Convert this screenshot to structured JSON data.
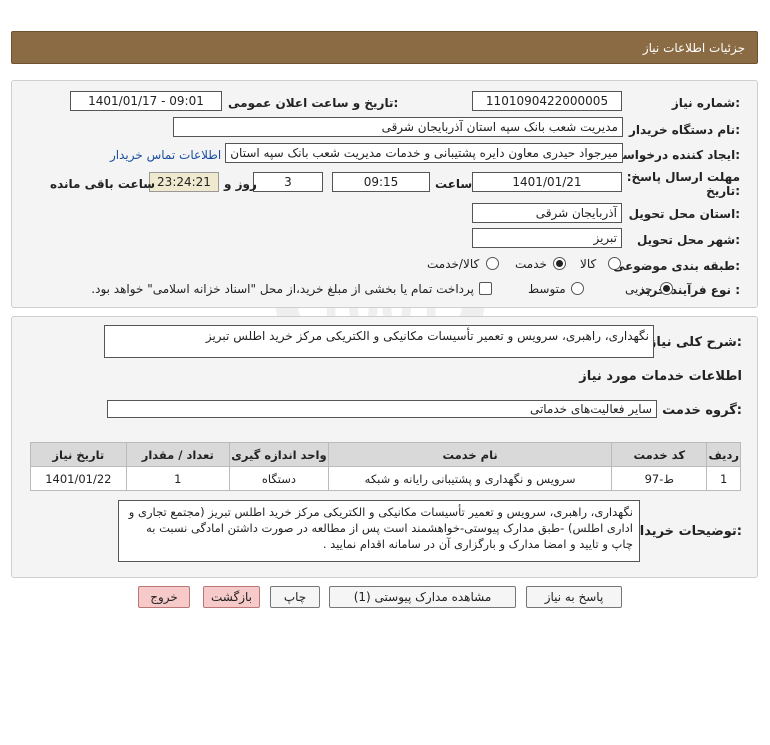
{
  "header": {
    "title": "جزئیات اطلاعات نیاز"
  },
  "form": {
    "need_number_label": "شماره نیاز:",
    "need_number": "1101090422000005",
    "announce_label": "تاریخ و ساعت اعلان عمومی:",
    "announce_value": "1401/01/17 - 09:01",
    "buyer_org_label": "نام دستگاه خریدار:",
    "buyer_org": "مدیریت شعب بانک سپه استان آذربایجان شرقی",
    "creator_label": "ایجاد کننده درخواست:",
    "creator": "میرجواد حیدری معاون دایره پشتیبانی و خدمات مدیریت شعب بانک سپه استان",
    "contact_link": "اطلاعات تماس خریدار",
    "deadline_label_1": "مهلت ارسال پاسخ: تا",
    "deadline_label_2": "تاریخ:",
    "deadline_date": "1401/01/21",
    "hour_label": "ساعت",
    "deadline_time": "09:15",
    "days_count": "3",
    "days_label": "روز و",
    "remaining_time": "23:24:21",
    "remaining_label": "ساعت باقی مانده",
    "province_label": "استان محل تحویل:",
    "province": "آذربایجان شرقی",
    "city_label": "شهر محل تحویل:",
    "city": "تبریز",
    "category_label": "طبقه بندی موضوعی:",
    "category_options": [
      "کالا",
      "خدمت",
      "کالا/خدمت"
    ],
    "category_selected": "خدمت",
    "purchase_type_label": "نوع فرآیند خرید :",
    "purchase_options": [
      "جزیی",
      "متوسط"
    ],
    "purchase_selected": "جزیی",
    "payment_note": "پرداخت تمام یا بخشی از مبلغ خرید،از محل \"اسناد خزانه اسلامی\" خواهد بود."
  },
  "details": {
    "general_desc_label": "شرح کلی نیاز:",
    "general_desc": "نگهداری، راهبری، سرویس و تعمیر تأسیسات مکانیکی و الکتریکی مرکز خرید اطلس تبریز",
    "services_heading": "اطلاعات خدمات مورد نیاز",
    "service_group_label": "گروه خدمت:",
    "service_group": "سایر فعالیت‌های خدماتی",
    "table": {
      "headers": [
        "ردیف",
        "کد خدمت",
        "نام خدمت",
        "واحد اندازه گیری",
        "تعداد / مقدار",
        "تاریخ نیاز"
      ],
      "rows": [
        [
          "1",
          "ط-97",
          "سرویس و نگهداری و پشتیبانی رایانه و شبکه",
          "دستگاه",
          "1",
          "1401/01/22"
        ]
      ]
    },
    "buyer_notes_label": "توضیحات خریدار:",
    "buyer_notes": "نگهداری، راهبری، سرویس و تعمیر تأسیسات مکانیکی و الکتریکی مرکز خرید اطلس تبریز (مجتمع تجاری و اداری اطلس) -طبق مدارک پیوستی-خواهشمند است پس از مطالعه در صورت داشتن امادگی نسبت به چاپ و تایید و امضا مدارک و بارگزاری آن در سامانه اقدام نمایید ."
  },
  "buttons": {
    "reply": "پاسخ به نیاز",
    "view_docs": "مشاهده مدارک پیوستی (1)",
    "print": "چاپ",
    "back": "بازگشت",
    "exit": "خروج"
  },
  "watermark": {
    "site": "ParsNamadData",
    "line1": "مرکز فراهم آوری اطلاعات پارس نماد داده",
    "line2": "پایگاه اطلاع رسانی مناقصه و مزایده"
  }
}
